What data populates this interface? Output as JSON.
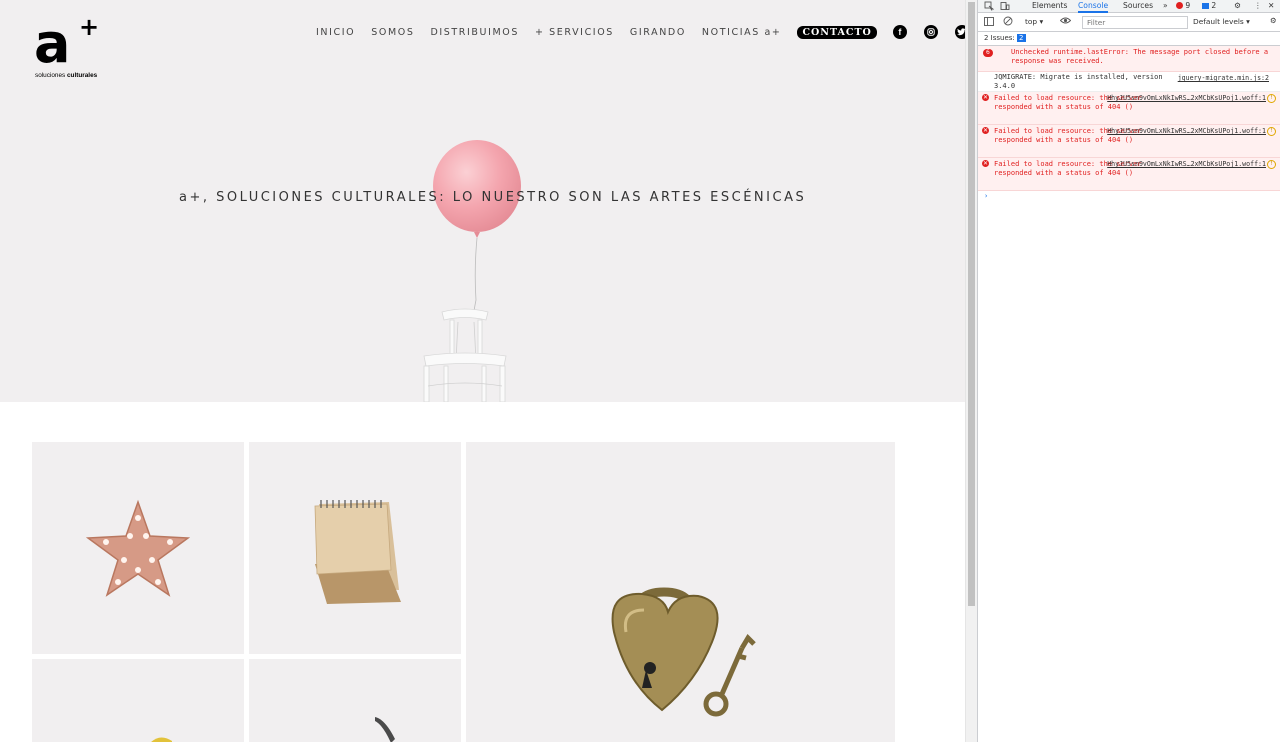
{
  "site": {
    "logo": {
      "mark": "a",
      "plus": "+",
      "sub_regular": "soluciones ",
      "sub_bold": "culturales"
    },
    "nav": {
      "items": [
        "INICIO",
        "SOMOS",
        "DISTRIBUIMOS",
        "+ SERVICIOS",
        "GIRANDO",
        "NOTICIAS a+"
      ],
      "contact": "CONTACTO",
      "social": [
        "facebook-icon",
        "instagram-icon",
        "twitter-icon"
      ],
      "search": "search-icon"
    },
    "hero_title": "a+, SOLUCIONES CULTURALES: LO NUESTRO SON LAS ARTES ESCÉNICAS",
    "colors": {
      "hero_bg": "#f1eff0",
      "balloon": "#f4a5ae",
      "search": "#c0392b"
    }
  },
  "devtools": {
    "tabs": {
      "elements": "Elements",
      "console": "Console",
      "sources": "Sources",
      "more": "»",
      "errors": "9",
      "messages": "2"
    },
    "toolbar": {
      "context": "top",
      "filter_placeholder": "Filter",
      "levels": "Default levels"
    },
    "issues": {
      "label": "2 Issues:",
      "count": "2"
    },
    "messages": [
      {
        "type": "error",
        "badge": "6",
        "text": "Unchecked runtime.lastError: The message port closed before a response was received.",
        "source": ""
      },
      {
        "type": "info",
        "text": "JQMIGRATE: Migrate is installed, version 3.4.0",
        "source": "jquery-migrate.min.js:2"
      },
      {
        "type": "error",
        "text": "Failed to load resource: the server responded with a status of 404 ()",
        "source": "HhyJU5sn9vOmLxNkIwRS…2xMCbKsUPoj1.woff:1"
      },
      {
        "type": "error",
        "text": "Failed to load resource: the server responded with a status of 404 ()",
        "source": "HhyJU5sn9vOmLxNkIwRS…2xMCbKsUPoj1.woff:1"
      },
      {
        "type": "error",
        "text": "Failed to load resource: the server responded with a status of 404 ()",
        "source": "HhyJU5sn9vOmLxNkIwRS…2xMCbKsUPoj1.woff:1"
      }
    ],
    "prompt": "›"
  }
}
